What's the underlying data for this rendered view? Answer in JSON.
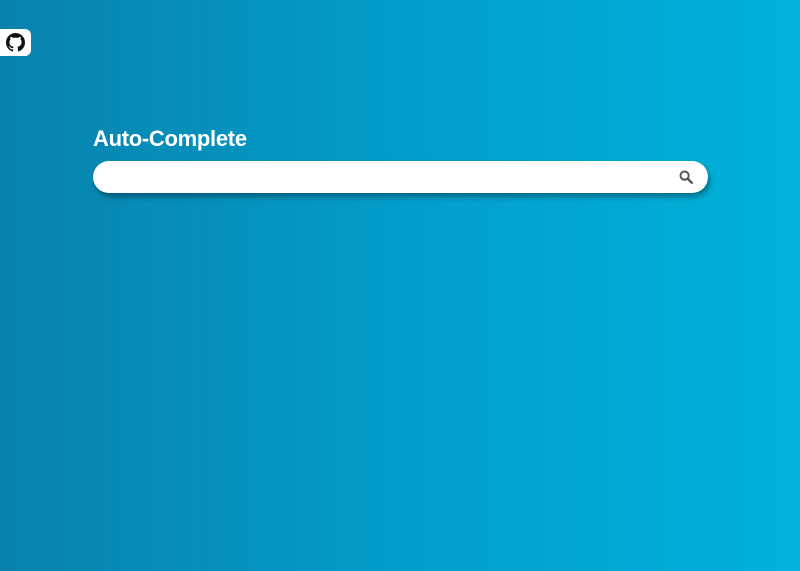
{
  "header": {
    "title": "Auto-Complete"
  },
  "search": {
    "value": "",
    "placeholder": ""
  },
  "icons": {
    "github_link": "github-icon",
    "search_button": "search-icon"
  },
  "colors": {
    "background_start": "#0882ac",
    "background_end": "#00b2da",
    "title_text": "#ffffff",
    "search_box": "#ffffff",
    "search_icon": "#555555"
  }
}
